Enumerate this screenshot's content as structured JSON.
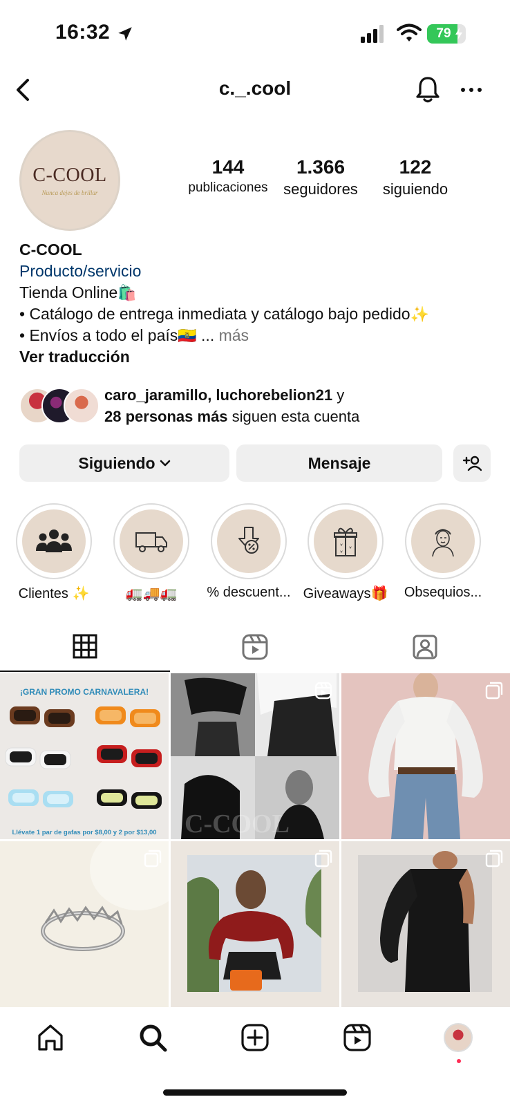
{
  "status_bar": {
    "time": "16:32",
    "battery": "79",
    "battery_level": 0.79,
    "icons": [
      "location-arrow-icon",
      "signal-icon",
      "wifi-icon",
      "battery-charging-icon"
    ]
  },
  "header": {
    "username": "c._.cool",
    "icons": [
      "back-chevron-icon",
      "bell-icon",
      "more-icon"
    ]
  },
  "profile": {
    "avatar_text": "C-COOL",
    "avatar_tagline": "Nunca dejes de brillar",
    "stats": {
      "posts": {
        "value": "144",
        "label": "publicaciones"
      },
      "followers": {
        "value": "1.366",
        "label": "seguidores"
      },
      "following": {
        "value": "122",
        "label": "siguiendo"
      }
    }
  },
  "bio": {
    "name": "C-COOL",
    "category": "Producto/servicio",
    "line1": "Tienda Online",
    "line1_emoji": "🛍️",
    "line2": "• Catálogo de entrega inmediata y catálogo bajo pedido",
    "line2_emoji": "✨",
    "line3": "• Envíos a todo el país",
    "line3_emoji": "🇪🇨",
    "more_prefix": " ... ",
    "more": "más",
    "translate": "Ver traducción"
  },
  "mutual": {
    "names": "caro_jaramillo, luchorebelion21",
    "and": " y",
    "others": "28 personas más",
    "suffix": " siguen esta cuenta"
  },
  "actions": {
    "following": "Siguiendo",
    "message": "Mensaje"
  },
  "highlights": [
    {
      "label": "Clientes ✨",
      "icon": "people-icon"
    },
    {
      "label": "🚛🚚🚛",
      "icon": "truck-icon"
    },
    {
      "label": "% descuent...",
      "icon": "discount-icon"
    },
    {
      "label": "Giveaways🎁",
      "icon": "gift-icon"
    },
    {
      "label": "Obsequios...",
      "icon": "woman-face-icon"
    }
  ],
  "tabs": [
    "grid-icon",
    "reels-icon",
    "tagged-icon"
  ],
  "posts": {
    "promo_title": "¡GRAN PROMO CARNAVALERA!",
    "promo_footer": "Llévate 1 par de gafas por $8,00 y 2 por $13,00",
    "watermark": "C-COOL"
  },
  "bottom_nav": [
    "home-icon",
    "search-icon",
    "create-icon",
    "reels-icon",
    "profile-icon"
  ]
}
